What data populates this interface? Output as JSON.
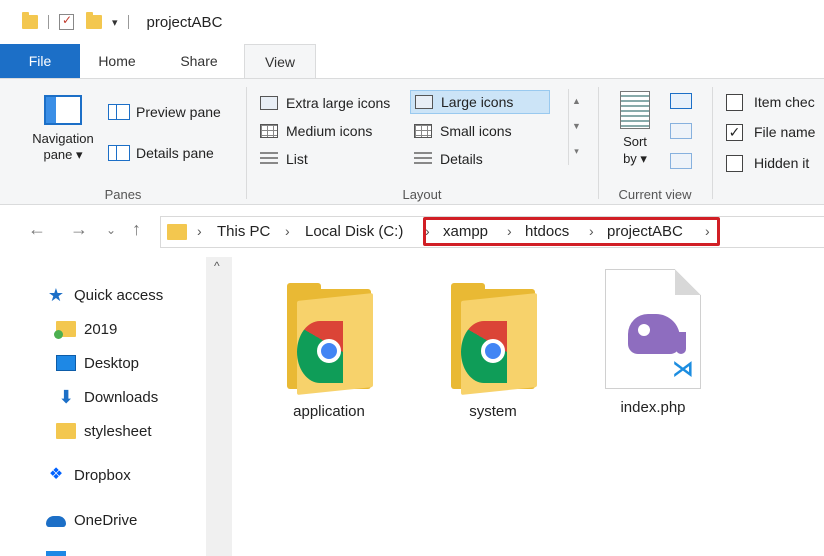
{
  "window": {
    "title": "projectABC"
  },
  "tabs": {
    "file": "File",
    "home": "Home",
    "share": "Share",
    "view": "View"
  },
  "panes": {
    "navigation_pane": "Navigation",
    "navigation_pane_sub": "pane ▾",
    "preview_pane": "Preview pane",
    "details_pane": "Details pane",
    "group_label": "Panes"
  },
  "layout": {
    "items": [
      "Extra large icons",
      "Large icons",
      "Medium icons",
      "Small icons",
      "List",
      "Details"
    ],
    "selected": "Large icons",
    "group_label": "Layout"
  },
  "current_view": {
    "sort_line1": "Sort",
    "sort_line2": "by ▾",
    "group_label": "Current view"
  },
  "show_hide": {
    "item_checkboxes": {
      "label": "Item chec",
      "checked": false
    },
    "file_name_extensions": {
      "label": "File name",
      "checked": true
    },
    "hidden_items": {
      "label": "Hidden it",
      "checked": false
    }
  },
  "address": {
    "crumbs": [
      "This PC",
      "Local Disk (C:)",
      "xampp",
      "htdocs",
      "projectABC"
    ]
  },
  "sidebar": {
    "items": [
      "Quick access",
      "2019",
      "Desktop",
      "Downloads",
      "stylesheet",
      "Dropbox",
      "OneDrive"
    ]
  },
  "files": [
    {
      "name": "application",
      "kind": "folder"
    },
    {
      "name": "system",
      "kind": "folder"
    },
    {
      "name": "index.php",
      "kind": "php-file"
    }
  ],
  "colors": {
    "accent": "#1c6fc7",
    "highlight_border": "#d11f25",
    "folder": "#f3c74f"
  }
}
